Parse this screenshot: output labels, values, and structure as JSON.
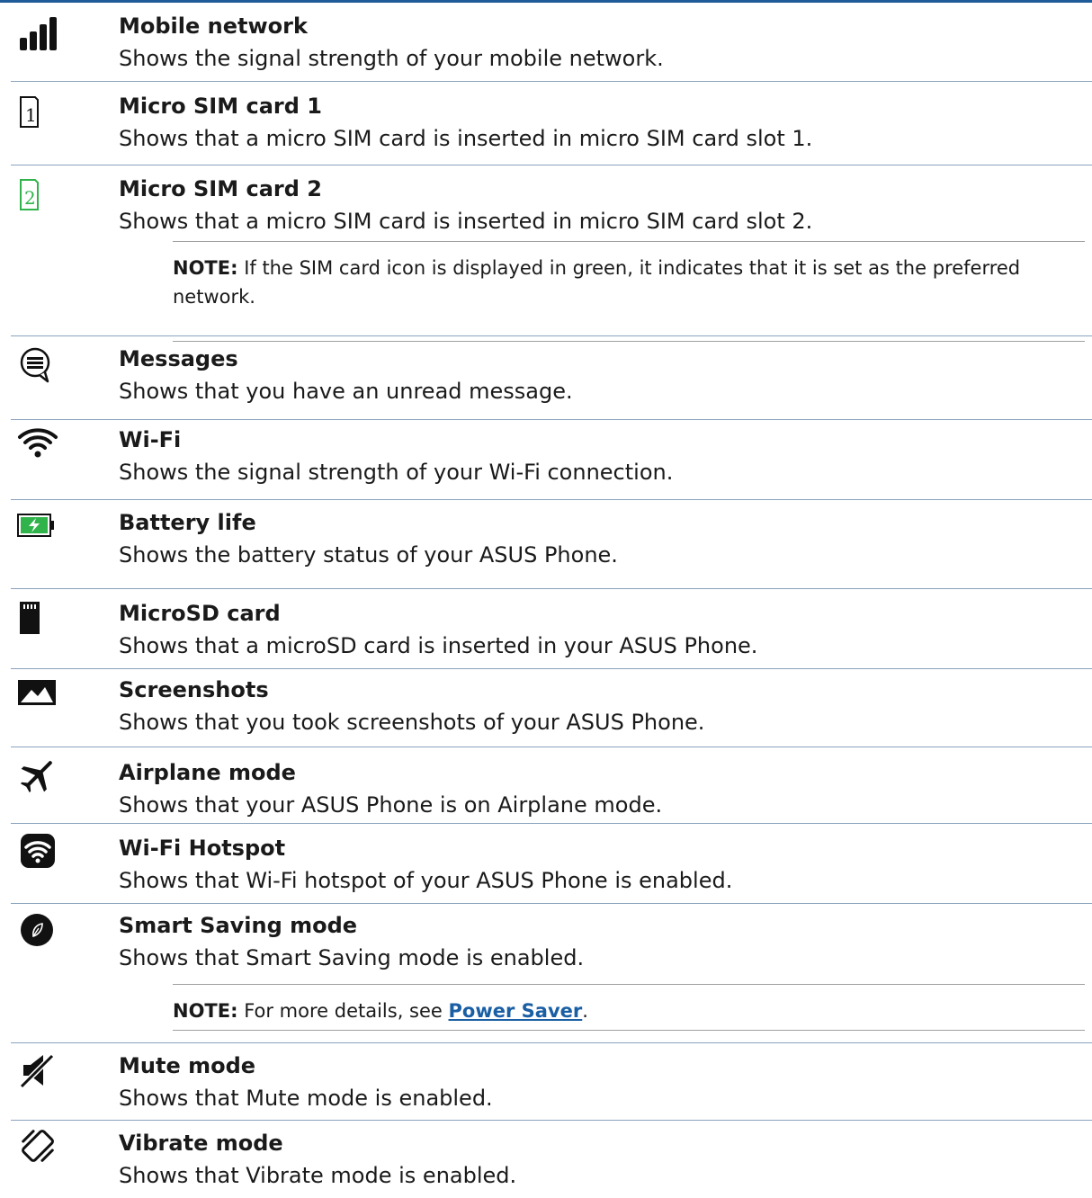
{
  "items": [
    {
      "icon": "signal-bars-icon",
      "title": "Mobile network",
      "desc": "Shows the signal strength of your mobile network."
    },
    {
      "icon": "sim-card-1-icon",
      "title": "Micro SIM card 1",
      "desc": "Shows that a micro SIM card is inserted in micro SIM card slot 1."
    },
    {
      "icon": "sim-card-2-icon",
      "title": "Micro SIM card 2",
      "desc": "Shows that a micro SIM card is inserted in micro SIM card slot 2."
    },
    {
      "icon": "message-icon",
      "title": "Messages",
      "desc": "Shows that you have an unread message."
    },
    {
      "icon": "wifi-icon",
      "title": "Wi-Fi",
      "desc": "Shows the signal strength of your Wi-Fi connection."
    },
    {
      "icon": "battery-icon",
      "title": "Battery life",
      "desc": "Shows the battery status of your ASUS Phone."
    },
    {
      "icon": "microsd-card-icon",
      "title": "MicroSD card",
      "desc": "Shows that a microSD card is inserted in your ASUS Phone."
    },
    {
      "icon": "screenshot-icon",
      "title": "Screenshots",
      "desc": "Shows that you took screenshots of your ASUS Phone."
    },
    {
      "icon": "airplane-icon",
      "title": "Airplane mode",
      "desc": "Shows that your ASUS Phone is on Airplane mode."
    },
    {
      "icon": "wifi-hotspot-icon",
      "title": "Wi-Fi Hotspot",
      "desc": "Shows that Wi-Fi hotspot of your ASUS Phone is enabled."
    },
    {
      "icon": "leaf-icon",
      "title": "Smart Saving mode",
      "desc": "Shows that Smart Saving mode is enabled."
    },
    {
      "icon": "mute-icon",
      "title": "Mute mode",
      "desc": "Shows that Mute mode is enabled."
    },
    {
      "icon": "vibrate-icon",
      "title": "Vibrate mode",
      "desc": "Shows that Vibrate mode is enabled."
    }
  ],
  "notes": {
    "sim": {
      "label": "NOTE:",
      "text": "If the SIM card icon is displayed in green, it indicates that it is set as the preferred network."
    },
    "saving": {
      "label": "NOTE:",
      "text_before": "For more details, see ",
      "link": "Power Saver",
      "text_after": "."
    }
  },
  "colors": {
    "accent": "#1f5c97",
    "sim_green": "#2fb34a",
    "battery_green": "#2fb34a",
    "link": "#1a5ea4"
  }
}
